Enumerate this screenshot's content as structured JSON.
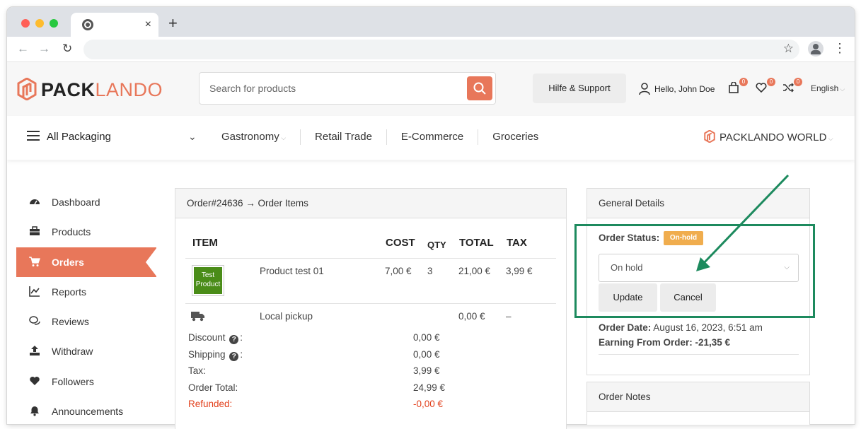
{
  "browser": {
    "tab_title": "",
    "url": "",
    "tab_close": "×",
    "new_tab": "+",
    "back": "←",
    "forward": "→",
    "reload": "↻",
    "star": "☆",
    "menu": "⋮"
  },
  "header": {
    "logo_part1": "PACK",
    "logo_part2": "LANDO",
    "search_placeholder": "Search for products",
    "support": "Hilfe & Support",
    "greeting": "Hello, John Doe",
    "cart_count": "0",
    "wishlist_count": "0",
    "compare_count": "0",
    "language": "English",
    "brand_color": "#e8775a"
  },
  "catnav": {
    "all": "All Packaging",
    "links": [
      "Gastronomy",
      "Retail Trade",
      "E-Commerce",
      "Groceries"
    ],
    "world": "PACKLANDO WORLD"
  },
  "sidebar": {
    "items": [
      {
        "label": "Dashboard",
        "icon": "dashboard-icon"
      },
      {
        "label": "Products",
        "icon": "briefcase-icon"
      },
      {
        "label": "Orders",
        "icon": "cart-icon"
      },
      {
        "label": "Reports",
        "icon": "chart-icon"
      },
      {
        "label": "Reviews",
        "icon": "comments-icon"
      },
      {
        "label": "Withdraw",
        "icon": "upload-icon"
      },
      {
        "label": "Followers",
        "icon": "heart-icon"
      },
      {
        "label": "Announcements",
        "icon": "bell-icon"
      }
    ]
  },
  "order_items": {
    "heading": "Order#24636 → Order Items",
    "columns": {
      "item": "ITEM",
      "cost": "COST",
      "qty": "QTY",
      "total": "TOTAL",
      "tax": "TAX"
    },
    "product": {
      "thumb_line1": "Test",
      "thumb_line2": "Product",
      "name": "Product test 01",
      "cost": "7,00 €",
      "qty": "3",
      "total": "21,00 €",
      "tax": "3,99 €"
    },
    "shipping_row": {
      "name": "Local pickup",
      "total": "0,00 €",
      "tax": "–"
    },
    "totals": {
      "discount_label": "Discount",
      "discount": "0,00 €",
      "shipping_label": "Shipping",
      "shipping": "0,00 €",
      "tax_label": "Tax:",
      "tax": "3,99 €",
      "order_total_label": "Order Total:",
      "order_total": "24,99 €",
      "refunded_label": "Refunded:",
      "refunded": "-0,00 €"
    }
  },
  "details": {
    "heading": "General Details",
    "status_label": "Order Status:",
    "status_badge": "On-hold",
    "status_value": "On hold",
    "update": "Update",
    "cancel": "Cancel",
    "order_date_label": "Order Date:",
    "order_date": "August 16, 2023, 6:51 am",
    "earning_label": "Earning From Order:",
    "earning": "-21,35 €"
  },
  "notes": {
    "heading": "Order Notes"
  },
  "annotation_color": "#1d8a5e"
}
